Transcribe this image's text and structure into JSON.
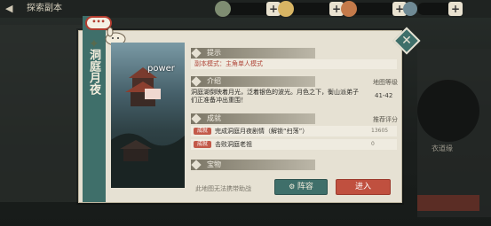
{
  "topbar": {
    "back_icon": "arrow-left-icon",
    "title": "探索副本",
    "resources": [
      "",
      "",
      "",
      ""
    ]
  },
  "side": {
    "right_label": "衣道缘"
  },
  "dungeon": {
    "title": "洞庭月夜",
    "bubble": "•••",
    "image_caption": "power"
  },
  "sections": {
    "tip": {
      "label": "提示",
      "text": "副本模式：主角单人模式"
    },
    "intro": {
      "label": "介绍",
      "text": "洞庭湖倒映着月光，泛着银色的波光。月色之下，衡山派弟子们正准备冲出重围！",
      "level_label": "地图等级",
      "level_value": "41-42",
      "score_label": "推荐评分"
    },
    "achievements": {
      "label": "成就",
      "items": [
        {
          "tag": "成就",
          "text": "完成洞庭月夜剧情（解锁“扫荡”）",
          "value": "13605"
        },
        {
          "tag": "成就",
          "text": "击败洞庭老祖",
          "value": "0"
        }
      ]
    },
    "treasure": {
      "label": "宝物"
    }
  },
  "footer": {
    "hint": "此地图无法携带助战",
    "team_button": "阵容",
    "enter_button": "进入"
  },
  "colors": {
    "accent_teal": "#3f6f6a",
    "accent_red": "#c0503f",
    "panel_bg": "#e6e1d3"
  }
}
